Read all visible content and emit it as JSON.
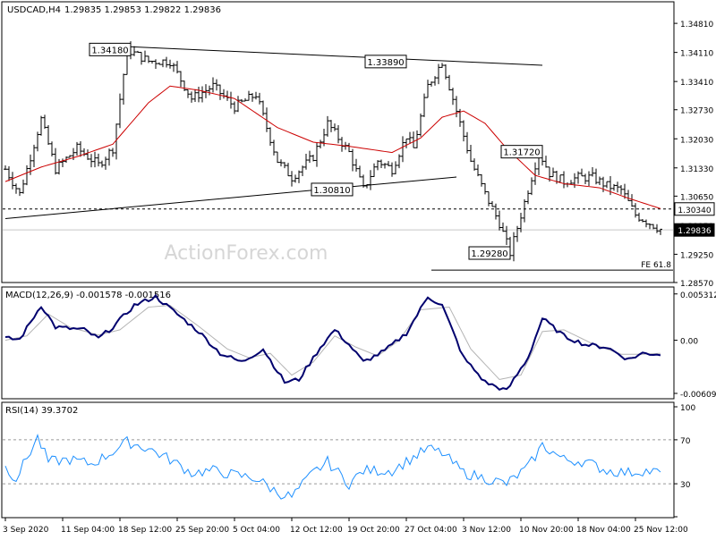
{
  "chart_data": [
    {
      "type": "candlestick",
      "header": {
        "symbol_tf": "USDCAD,H4",
        "ohlc": "1.29835 1.29853 1.29822 1.29836"
      },
      "watermark": "ActionForex.com",
      "price_axis": {
        "ylim": [
          1.2857,
          1.352
        ],
        "ticks": [
          "1.34810",
          "1.34110",
          "1.33410",
          "1.32730",
          "1.32030",
          "1.31330",
          "1.30650",
          "1.29950",
          "1.29250",
          "1.28570"
        ],
        "tick_values": [
          1.3481,
          1.3411,
          1.3341,
          1.3273,
          1.3203,
          1.3133,
          1.3065,
          1.2995,
          1.2925,
          1.2857
        ],
        "current_labels": [
          {
            "text": "1.30340",
            "value": 1.3034,
            "style": "box"
          },
          {
            "text": "1.29836",
            "value": 1.29836,
            "style": "dark"
          }
        ]
      },
      "annotations": [
        {
          "text": "1.34180",
          "bar": 34,
          "value": 1.3418
        },
        {
          "text": "1.33890",
          "bar": 111,
          "value": 1.3389
        },
        {
          "text": "1.30810",
          "bar": 96,
          "value": 1.3081
        },
        {
          "text": "1.31720",
          "bar": 149,
          "value": 1.3172
        },
        {
          "text": "1.29280",
          "bar": 141,
          "value": 1.2928
        },
        {
          "text": "FE 61.8",
          "value": 1.2887
        }
      ],
      "trendlines": [
        {
          "from": [
            34,
            1.3425
          ],
          "to": [
            150,
            1.338
          ]
        },
        {
          "from": [
            0,
            1.3011
          ],
          "to": [
            126,
            1.3111
          ]
        }
      ],
      "horizontal_lines": [
        {
          "value": 1.3034,
          "style": "dashed"
        },
        {
          "value": 1.2887,
          "style": "solid"
        }
      ],
      "key_points": [
        [
          0,
          1.313
        ],
        [
          4,
          1.307
        ],
        [
          10,
          1.325
        ],
        [
          14,
          1.313
        ],
        [
          20,
          1.318
        ],
        [
          26,
          1.314
        ],
        [
          30,
          1.318
        ],
        [
          34,
          1.3418
        ],
        [
          40,
          1.339
        ],
        [
          46,
          1.339
        ],
        [
          52,
          1.33
        ],
        [
          58,
          1.333
        ],
        [
          64,
          1.328
        ],
        [
          70,
          1.331
        ],
        [
          76,
          1.315
        ],
        [
          80,
          1.311
        ],
        [
          86,
          1.316
        ],
        [
          90,
          1.324
        ],
        [
          96,
          1.317
        ],
        [
          100,
          1.3081
        ],
        [
          104,
          1.315
        ],
        [
          108,
          1.313
        ],
        [
          112,
          1.321
        ],
        [
          114,
          1.318
        ],
        [
          118,
          1.333
        ],
        [
          122,
          1.3389
        ],
        [
          126,
          1.327
        ],
        [
          130,
          1.315
        ],
        [
          134,
          1.307
        ],
        [
          138,
          1.3
        ],
        [
          141,
          1.2928
        ],
        [
          145,
          1.305
        ],
        [
          149,
          1.3172
        ],
        [
          152,
          1.312
        ],
        [
          156,
          1.31
        ],
        [
          160,
          1.311
        ],
        [
          164,
          1.311
        ],
        [
          168,
          1.309
        ],
        [
          172,
          1.308
        ],
        [
          176,
          1.302
        ],
        [
          180,
          1.3
        ],
        [
          183,
          1.2985
        ]
      ],
      "sma_key_points": [
        [
          0,
          1.31
        ],
        [
          10,
          1.3135
        ],
        [
          20,
          1.316
        ],
        [
          30,
          1.319
        ],
        [
          40,
          1.329
        ],
        [
          46,
          1.333
        ],
        [
          54,
          1.332
        ],
        [
          64,
          1.33
        ],
        [
          76,
          1.323
        ],
        [
          86,
          1.3195
        ],
        [
          96,
          1.3185
        ],
        [
          108,
          1.317
        ],
        [
          116,
          1.3205
        ],
        [
          122,
          1.3255
        ],
        [
          128,
          1.327
        ],
        [
          134,
          1.324
        ],
        [
          140,
          1.318
        ],
        [
          148,
          1.3115
        ],
        [
          156,
          1.3095
        ],
        [
          166,
          1.3085
        ],
        [
          174,
          1.306
        ],
        [
          183,
          1.3035
        ]
      ]
    },
    {
      "type": "line",
      "label": "MACD(12,26,9) -0.001578 -0.001516",
      "ylim": [
        -0.0065,
        0.0058
      ],
      "ticks": [
        "0.005312",
        "0.00",
        "-0.006092"
      ],
      "tick_values": [
        0.005312,
        0,
        -0.006092
      ],
      "macd_key_points": [
        [
          0,
          0.0002
        ],
        [
          4,
          0.0001
        ],
        [
          10,
          0.004
        ],
        [
          14,
          0.0015
        ],
        [
          22,
          0.0012
        ],
        [
          26,
          0.0002
        ],
        [
          30,
          0.0015
        ],
        [
          36,
          0.004
        ],
        [
          42,
          0.005
        ],
        [
          48,
          0.003
        ],
        [
          54,
          0.001
        ],
        [
          60,
          -0.0015
        ],
        [
          66,
          -0.0025
        ],
        [
          72,
          -0.001
        ],
        [
          78,
          -0.0048
        ],
        [
          82,
          -0.0045
        ],
        [
          88,
          -0.0008
        ],
        [
          92,
          0.0012
        ],
        [
          96,
          -0.0005
        ],
        [
          100,
          -0.0025
        ],
        [
          106,
          -0.0012
        ],
        [
          112,
          0.0008
        ],
        [
          118,
          0.005
        ],
        [
          122,
          0.004
        ],
        [
          128,
          -0.002
        ],
        [
          134,
          -0.0048
        ],
        [
          140,
          -0.0058
        ],
        [
          146,
          -0.002
        ],
        [
          150,
          0.0025
        ],
        [
          156,
          0.0005
        ],
        [
          162,
          -0.0005
        ],
        [
          168,
          -0.0008
        ],
        [
          174,
          -0.0022
        ],
        [
          178,
          -0.0015
        ],
        [
          183,
          -0.0016
        ]
      ],
      "signal_key_points": [
        [
          0,
          0.0
        ],
        [
          6,
          0.0005
        ],
        [
          12,
          0.003
        ],
        [
          18,
          0.0015
        ],
        [
          26,
          0.0006
        ],
        [
          32,
          0.0012
        ],
        [
          40,
          0.0038
        ],
        [
          46,
          0.004
        ],
        [
          54,
          0.0016
        ],
        [
          62,
          -0.001
        ],
        [
          68,
          -0.002
        ],
        [
          74,
          -0.0015
        ],
        [
          80,
          -0.004
        ],
        [
          86,
          -0.0025
        ],
        [
          92,
          0.0005
        ],
        [
          98,
          -0.0008
        ],
        [
          104,
          -0.0018
        ],
        [
          110,
          0.0
        ],
        [
          116,
          0.0035
        ],
        [
          124,
          0.0038
        ],
        [
          130,
          -0.001
        ],
        [
          138,
          -0.0045
        ],
        [
          144,
          -0.004
        ],
        [
          150,
          0.001
        ],
        [
          156,
          0.0012
        ],
        [
          164,
          -0.0004
        ],
        [
          172,
          -0.0016
        ],
        [
          178,
          -0.0016
        ],
        [
          183,
          -0.0015
        ]
      ]
    },
    {
      "type": "line",
      "label": "RSI(14) 39.3702",
      "ylim": [
        0,
        100
      ],
      "ticks": [
        "100",
        "70",
        "30",
        "0"
      ],
      "tick_values": [
        100,
        70,
        30,
        0
      ],
      "levels": [
        70,
        30
      ],
      "rsi_key_points": [
        [
          0,
          45
        ],
        [
          3,
          35
        ],
        [
          9,
          72
        ],
        [
          12,
          50
        ],
        [
          18,
          52
        ],
        [
          24,
          48
        ],
        [
          28,
          55
        ],
        [
          34,
          68
        ],
        [
          40,
          62
        ],
        [
          46,
          52
        ],
        [
          52,
          40
        ],
        [
          58,
          42
        ],
        [
          64,
          38
        ],
        [
          70,
          35
        ],
        [
          76,
          22
        ],
        [
          80,
          18
        ],
        [
          86,
          40
        ],
        [
          90,
          50
        ],
        [
          96,
          30
        ],
        [
          100,
          42
        ],
        [
          108,
          42
        ],
        [
          112,
          50
        ],
        [
          118,
          62
        ],
        [
          122,
          58
        ],
        [
          128,
          40
        ],
        [
          134,
          35
        ],
        [
          140,
          30
        ],
        [
          146,
          45
        ],
        [
          150,
          65
        ],
        [
          156,
          52
        ],
        [
          162,
          50
        ],
        [
          168,
          42
        ],
        [
          174,
          40
        ],
        [
          178,
          42
        ],
        [
          183,
          40
        ]
      ]
    }
  ],
  "time_axis": {
    "labels": [
      "3 Sep 2020",
      "11 Sep 04:00",
      "18 Sep 12:00",
      "25 Sep 20:00",
      "5 Oct 04:00",
      "12 Oct 12:00",
      "19 Oct 20:00",
      "27 Oct 04:00",
      "3 Nov 12:00",
      "10 Nov 20:00",
      "18 Nov 04:00",
      "25 Nov 12:00"
    ],
    "label_bars": [
      0,
      16,
      32,
      48,
      64,
      80,
      96,
      112,
      128,
      144,
      160,
      176
    ]
  },
  "colors": {
    "sma": "#cc0000",
    "macd": "#00006e",
    "signal": "#b4b4b4",
    "rsi": "#1e90ff",
    "watermark": "#d6d6d6"
  }
}
